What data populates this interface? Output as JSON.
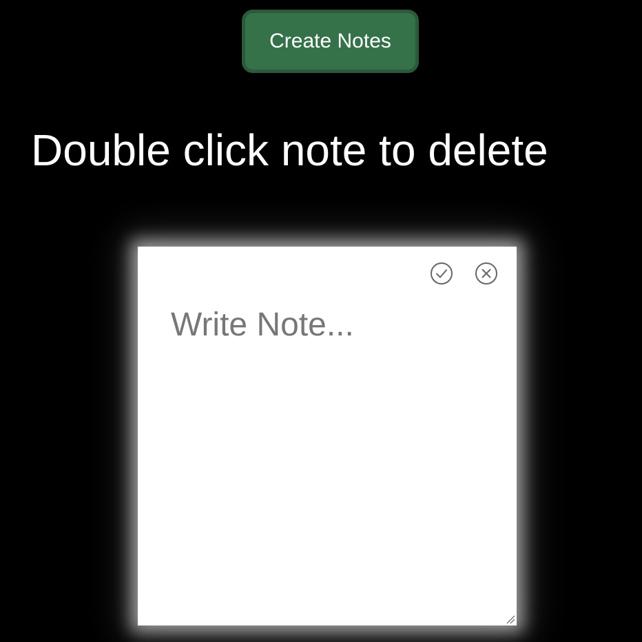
{
  "toolbar": {
    "create_label": "Create Notes"
  },
  "instructions": {
    "text": "Double click note to delete"
  },
  "note": {
    "placeholder": "Write Note...",
    "value": "",
    "icons": {
      "save": "check-circle-icon",
      "close": "x-circle-icon"
    }
  },
  "colors": {
    "background": "#000000",
    "button_fill": "#357149",
    "button_border": "#2b5a3a",
    "note_fill": "#ffffff",
    "icon_stroke": "#666666"
  }
}
